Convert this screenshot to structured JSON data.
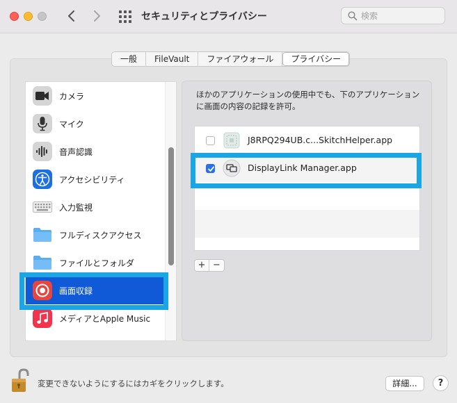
{
  "window": {
    "title": "セキュリティとプライバシー",
    "search_placeholder": "検索"
  },
  "tabs": [
    {
      "label": "一般",
      "active": false
    },
    {
      "label": "FileVault",
      "active": false
    },
    {
      "label": "ファイアウォール",
      "active": false
    },
    {
      "label": "プライバシー",
      "active": true
    }
  ],
  "categories": [
    {
      "label": "カメラ",
      "icon": "camera-icon"
    },
    {
      "label": "マイク",
      "icon": "microphone-icon"
    },
    {
      "label": "音声認識",
      "icon": "speech-recognition-icon"
    },
    {
      "label": "アクセシビリティ",
      "icon": "accessibility-icon"
    },
    {
      "label": "入力監視",
      "icon": "keyboard-icon"
    },
    {
      "label": "フルディスクアクセス",
      "icon": "folder-icon"
    },
    {
      "label": "ファイルとフォルダ",
      "icon": "folder-icon"
    },
    {
      "label": "画面収録",
      "icon": "screen-recording-icon",
      "selected": true
    },
    {
      "label": "メディアとApple Music",
      "icon": "music-icon"
    }
  ],
  "description": "ほかのアプリケーションの使用中でも、下のアプリケーションに画面の内容の記録を許可。",
  "apps": [
    {
      "label": "J8RPQ294UB.c...SkitchHelper.app",
      "checked": false,
      "icon": "skitch-helper-icon"
    },
    {
      "label": "DisplayLink Manager.app",
      "checked": true,
      "icon": "displaylink-icon"
    }
  ],
  "list_controls": {
    "add": "+",
    "remove": "−"
  },
  "footer": {
    "lock_text": "変更できないようにするにはカギをクリックします。",
    "details_label": "詳細...",
    "help_label": "?"
  },
  "colors": {
    "selection": "#1059d7",
    "highlight_frame": "#1aa6e5",
    "checkbox_checked": "#2a70e8"
  }
}
